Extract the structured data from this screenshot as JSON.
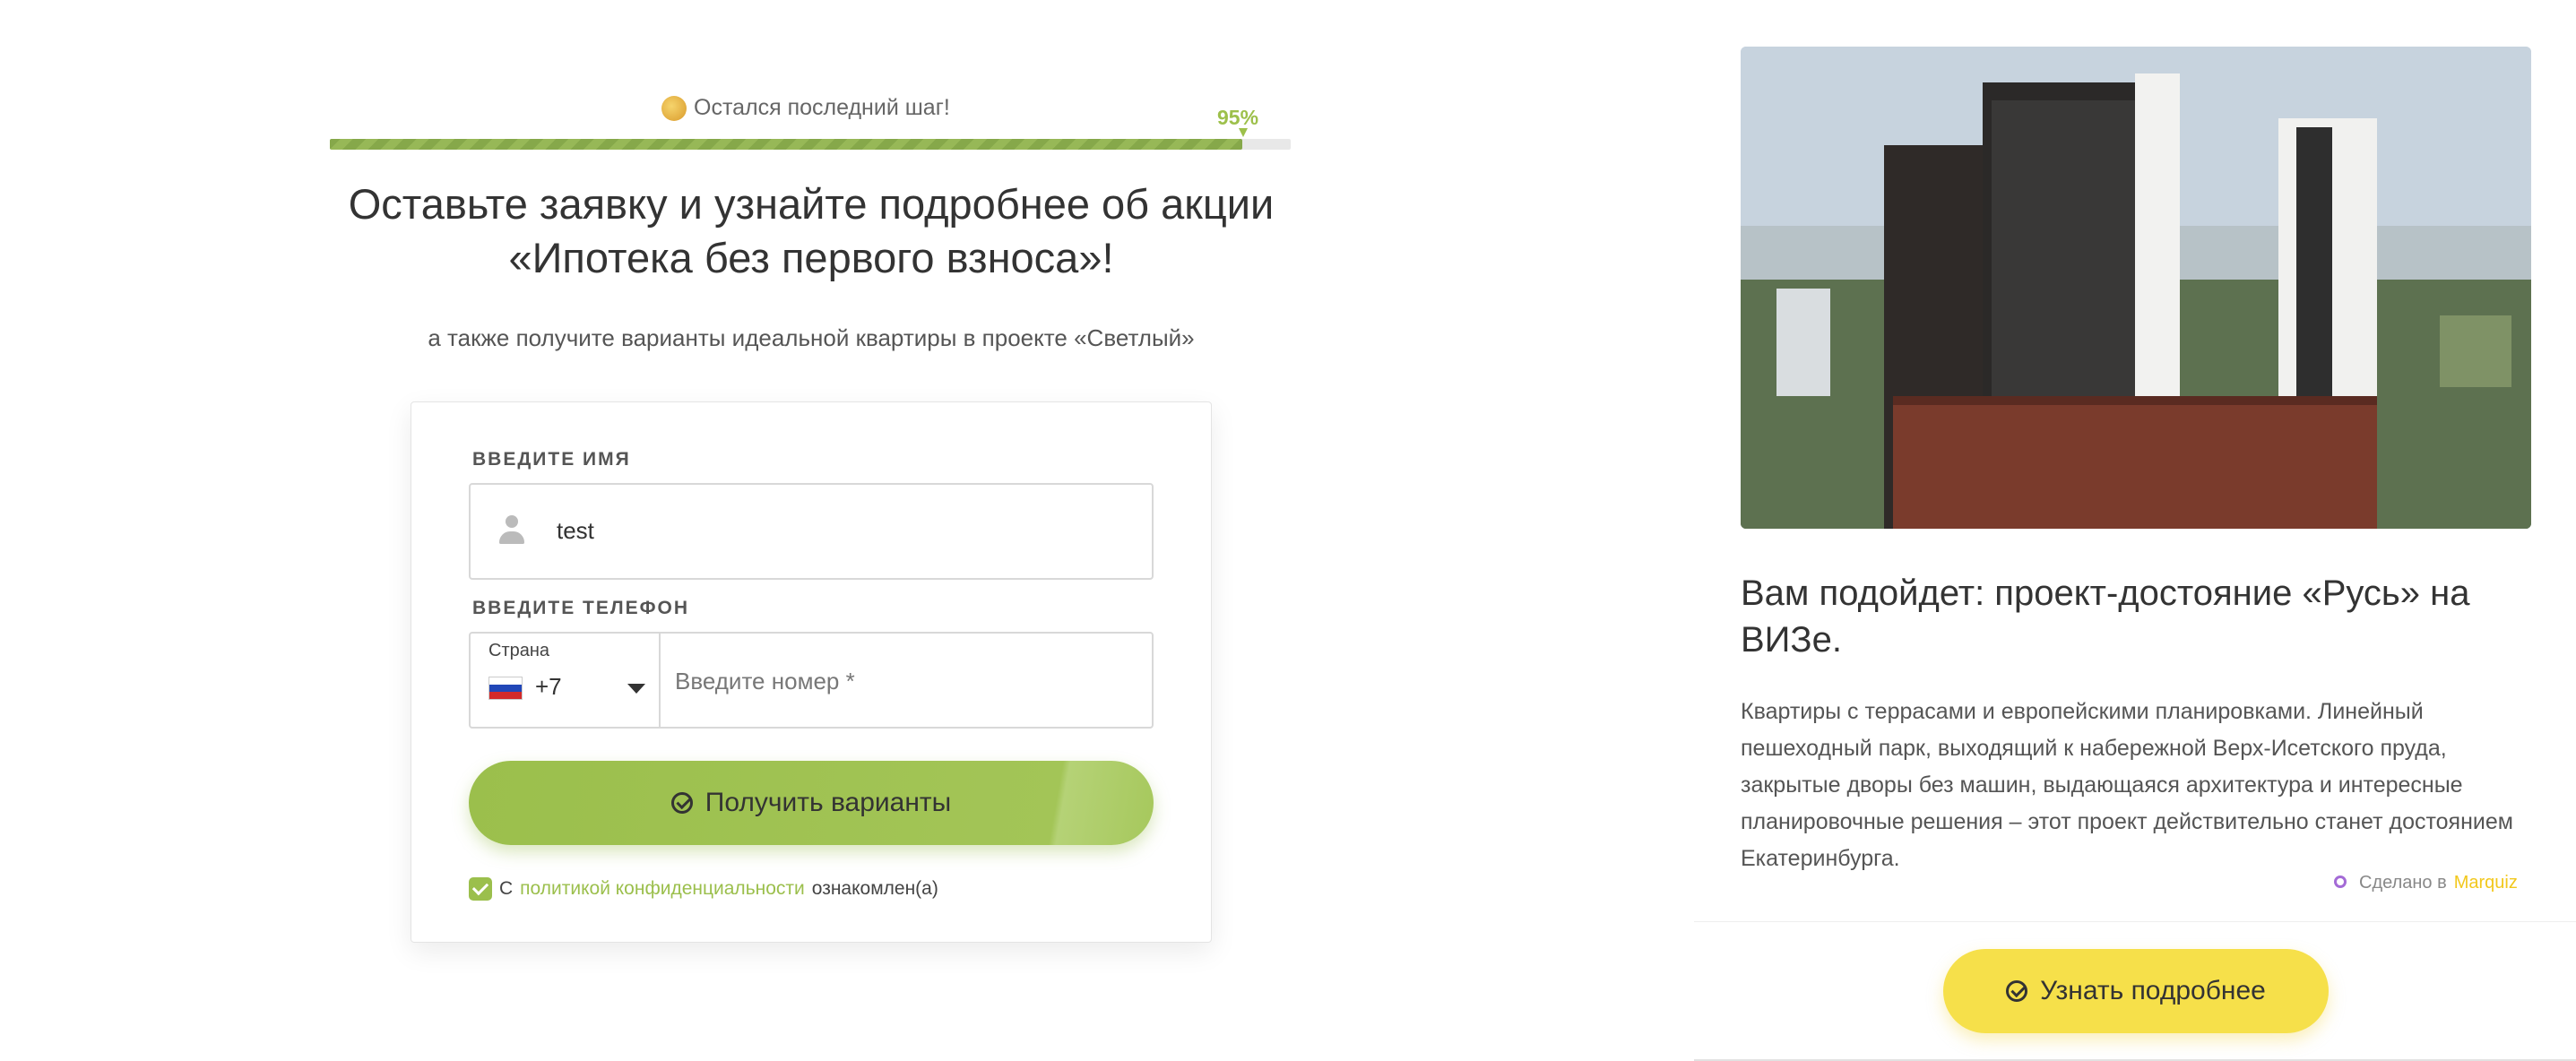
{
  "progress": {
    "label": "Остался последний шаг!",
    "percent_text": "95%",
    "value": 0.95
  },
  "heading": {
    "title": "Оставьте заявку и узнайте подробнее об акции «Ипотека без первого взноса»!",
    "subtitle": "а также получите варианты идеальной квартиры в проекте «Светлый»"
  },
  "form": {
    "name_label": "ВВЕДИТЕ ИМЯ",
    "name_value": "test",
    "phone_label": "ВВЕДИТЕ ТЕЛЕФОН",
    "country_label": "Страна",
    "dial_code": "+7",
    "phone_placeholder": "Введите номер *",
    "submit_label": "Получить варианты",
    "consent_prefix": "С",
    "consent_link": "политикой конфиденциальности",
    "consent_suffix": "ознакомлен(а)"
  },
  "card": {
    "title": "Вам подойдет: проект-достояние «Русь» на ВИЗе.",
    "text": "Квартиры с террасами и европейскими планировками. Линейный пешеходный парк, выходящий к набережной Верх-Исетского пруда, закрытые дворы без машин, выдающаяся архитектура и интересные планировочные решения – этот проект действительно станет достоянием Екатеринбурга.",
    "made_in_prefix": "Сделано в",
    "made_in_brand": "Marquiz",
    "more_label": "Узнать подробнее"
  },
  "colors": {
    "accent_green": "#9bbf4c",
    "accent_yellow": "#f6e04a"
  }
}
